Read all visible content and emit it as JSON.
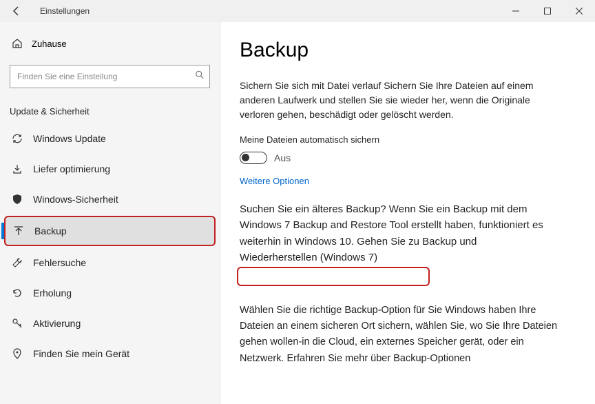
{
  "window": {
    "title": "Einstellungen"
  },
  "sidebar": {
    "home": "Zuhause",
    "searchPlaceholder": "Finden Sie eine Einstellung",
    "sectionHeader": "Update & Sicherheit",
    "items": [
      {
        "label": "Windows Update"
      },
      {
        "label": "Liefer optimierung"
      },
      {
        "label": "Windows-Sicherheit"
      },
      {
        "label": "Backup"
      },
      {
        "label": "Fehlersuche"
      },
      {
        "label": "Erholung"
      },
      {
        "label": "Aktivierung"
      },
      {
        "label": "Finden Sie mein Gerät"
      }
    ]
  },
  "main": {
    "title": "Backup",
    "intro": "Sichern Sie sich mit Datei verlauf Sichern Sie Ihre Dateien auf einem anderen Laufwerk und stellen Sie sie wieder her, wenn die Originale verloren gehen, beschädigt oder gelöscht werden.",
    "autoBackupLabel": "Meine Dateien automatisch sichern",
    "toggleState": "Aus",
    "moreOptions": "Weitere Optionen",
    "olderBackup": "Suchen Sie ein älteres Backup? Wenn Sie ein Backup mit dem Windows 7 Backup and Restore Tool erstellt haben, funktioniert es weiterhin in Windows 10. Gehen Sie zu Backup und Wiederherstellen (Windows 7)",
    "chooseOption": "Wählen Sie die richtige Backup-Option für Sie Windows haben Ihre Dateien an einem sicheren Ort sichern, wählen Sie, wo Sie Ihre Dateien gehen wollen-in die Cloud, ein externes Speicher gerät, oder ein Netzwerk. Erfahren Sie mehr über Backup-Optionen"
  }
}
